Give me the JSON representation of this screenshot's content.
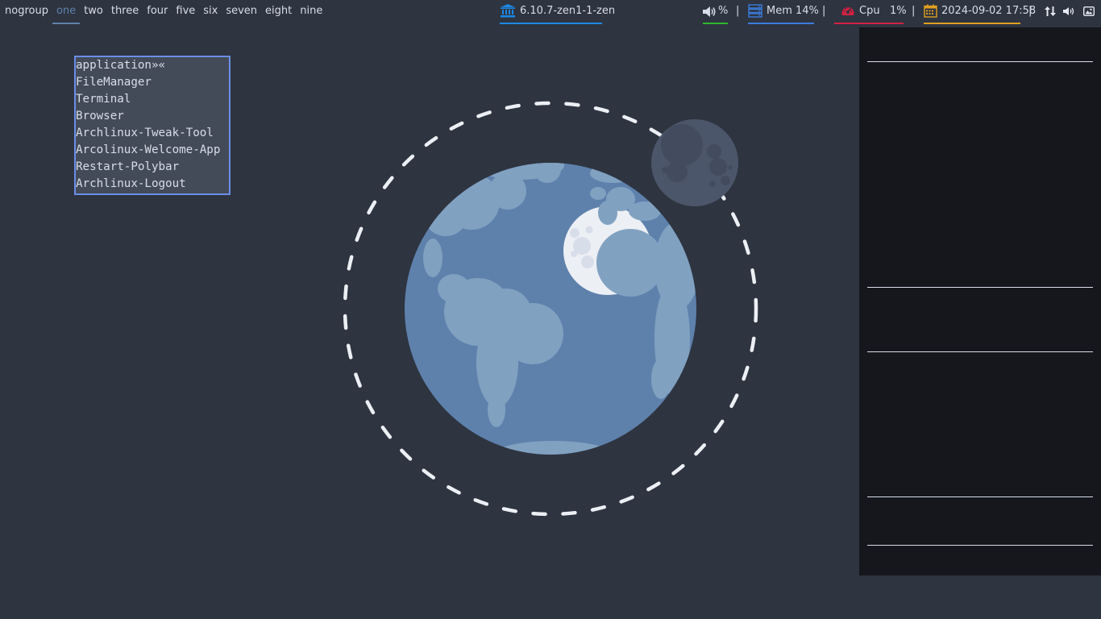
{
  "bar": {
    "workspaces": [
      {
        "label": "nogroup",
        "active": false
      },
      {
        "label": "one",
        "active": true
      },
      {
        "label": "two",
        "active": false
      },
      {
        "label": "three",
        "active": false
      },
      {
        "label": "four",
        "active": false
      },
      {
        "label": "five",
        "active": false
      },
      {
        "label": "six",
        "active": false
      },
      {
        "label": "seven",
        "active": false
      },
      {
        "label": "eight",
        "active": false
      },
      {
        "label": "nine",
        "active": false
      }
    ],
    "kernel": {
      "icon": "bank-icon",
      "text": "6.10.7-zen1-1-zen",
      "color": "#1e88e5"
    },
    "volume": {
      "icon": "speaker-icon",
      "text": "%",
      "color": "#2eb82e"
    },
    "memory": {
      "icon": "server-icon",
      "text": "Mem 14%",
      "color": "#3b7ddd"
    },
    "cpu": {
      "icon": "gauge-icon",
      "text": "Cpu   1%",
      "color": "#d42040"
    },
    "date": {
      "icon": "calendar-icon",
      "text": "2024-09-02 17:58",
      "color": "#e0a020"
    },
    "separator": "|",
    "tray": [
      "network-arrows-icon",
      "speaker-tray-icon",
      "image-tray-icon"
    ]
  },
  "menu": {
    "header": "application»«",
    "items": [
      "FileManager",
      "Terminal",
      "Browser",
      "Archlinux-Tweak-Tool",
      "Arcolinux-Welcome-App",
      "Restart-Polybar",
      "Archlinux-Logout"
    ]
  },
  "colors": {
    "background": "#2e3440",
    "accent": "#5e81ac",
    "menu_border": "#6a8fe8",
    "panel": "#15171c"
  }
}
